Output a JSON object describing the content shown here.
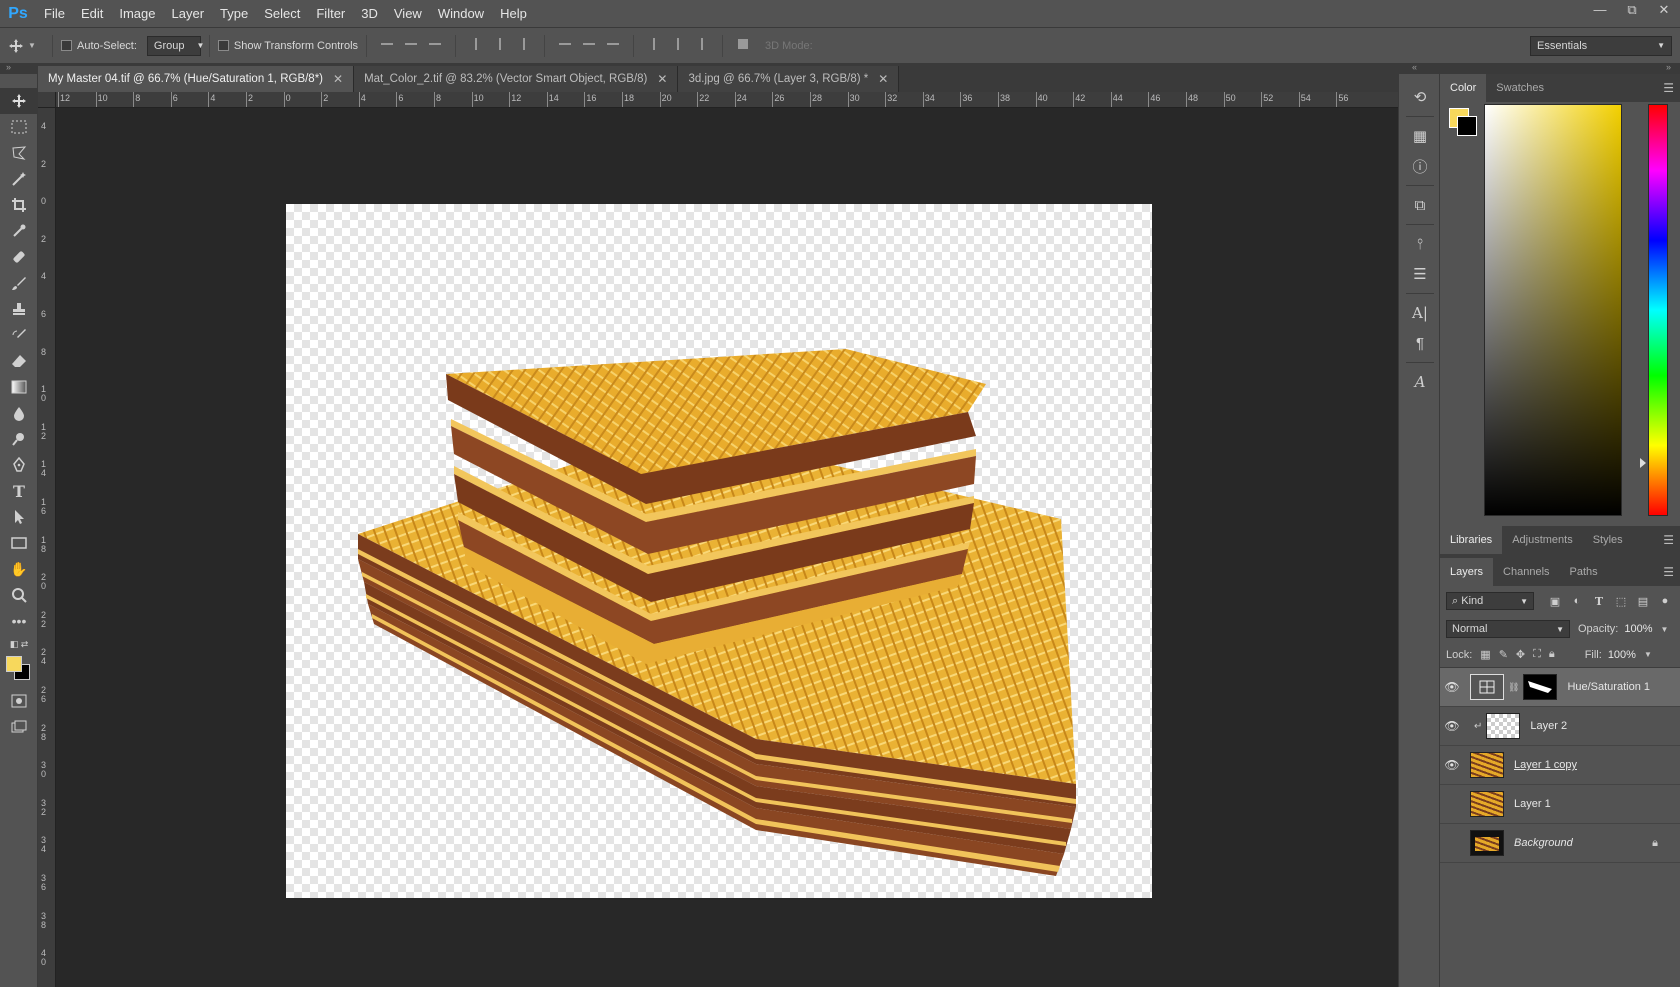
{
  "app": {
    "logo": "Ps"
  },
  "menu": [
    "File",
    "Edit",
    "Image",
    "Layer",
    "Type",
    "Select",
    "Filter",
    "3D",
    "View",
    "Window",
    "Help"
  ],
  "window_controls": {
    "minimize": "—",
    "restore": "⧉",
    "close": "✕"
  },
  "options": {
    "auto_select_label": "Auto-Select:",
    "auto_select_value": "Group",
    "show_transform_label": "Show Transform Controls",
    "mode_3d_label": "3D Mode:",
    "workspace": "Essentials"
  },
  "tabs": [
    {
      "label": "My Master 04.tif @ 66.7% (Hue/Saturation 1, RGB/8*)",
      "active": true
    },
    {
      "label": "Mat_Color_2.tif @ 83.2% (Vector Smart Object, RGB/8)",
      "active": false
    },
    {
      "label": "3d.jpg @ 66.7% (Layer 3, RGB/8) *",
      "active": false
    }
  ],
  "ruler_top": [
    "12",
    "10",
    "8",
    "6",
    "4",
    "2",
    "0",
    "2",
    "4",
    "6",
    "8",
    "10",
    "12",
    "14",
    "16",
    "18",
    "20",
    "22",
    "24",
    "26",
    "28",
    "30",
    "32",
    "34",
    "36",
    "38",
    "40",
    "42",
    "44",
    "46",
    "48",
    "50",
    "52",
    "54",
    "56"
  ],
  "ruler_left": [
    "4",
    "2",
    "0",
    "2",
    "4",
    "6",
    "8",
    "10",
    "12",
    "14",
    "16",
    "18",
    "20",
    "22",
    "24",
    "26",
    "28",
    "30",
    "32",
    "34",
    "36",
    "38",
    "40"
  ],
  "color_panel": {
    "tabs": [
      "Color",
      "Swatches"
    ],
    "foreground": "#f7d85c",
    "background": "#000000"
  },
  "libraries_tabs": [
    "Libraries",
    "Adjustments",
    "Styles"
  ],
  "layers_panel": {
    "tabs": [
      "Layers",
      "Channels",
      "Paths"
    ],
    "filter_kind": "Kind",
    "blend_mode": "Normal",
    "opacity_label": "Opacity:",
    "opacity_value": "100%",
    "lock_label": "Lock:",
    "fill_label": "Fill:",
    "fill_value": "100%",
    "layers": [
      {
        "name": "Hue/Saturation 1",
        "visible": true,
        "selected": true
      },
      {
        "name": "Layer 2",
        "visible": true,
        "selected": false
      },
      {
        "name": "Layer 1 copy",
        "visible": true,
        "selected": false
      },
      {
        "name": "Layer 1",
        "visible": false,
        "selected": false
      },
      {
        "name": "Background",
        "visible": false,
        "selected": false
      }
    ]
  }
}
